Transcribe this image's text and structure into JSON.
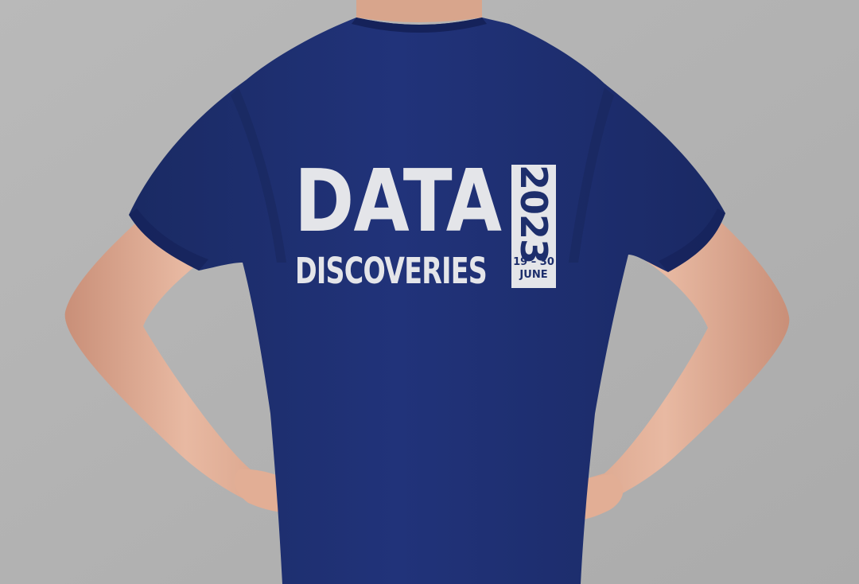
{
  "photo": {
    "subject": "person-back-tshirt",
    "colors": {
      "background": "#b3b3b3",
      "shirt": "#1d2e6c",
      "print": "#e4e5e9",
      "skin": "#e2ae95"
    }
  },
  "print": {
    "title_line1": "DATA",
    "title_line2": "DISCOVERIES",
    "year": "2023",
    "dates": "19 – 30",
    "month": "JUNE"
  }
}
